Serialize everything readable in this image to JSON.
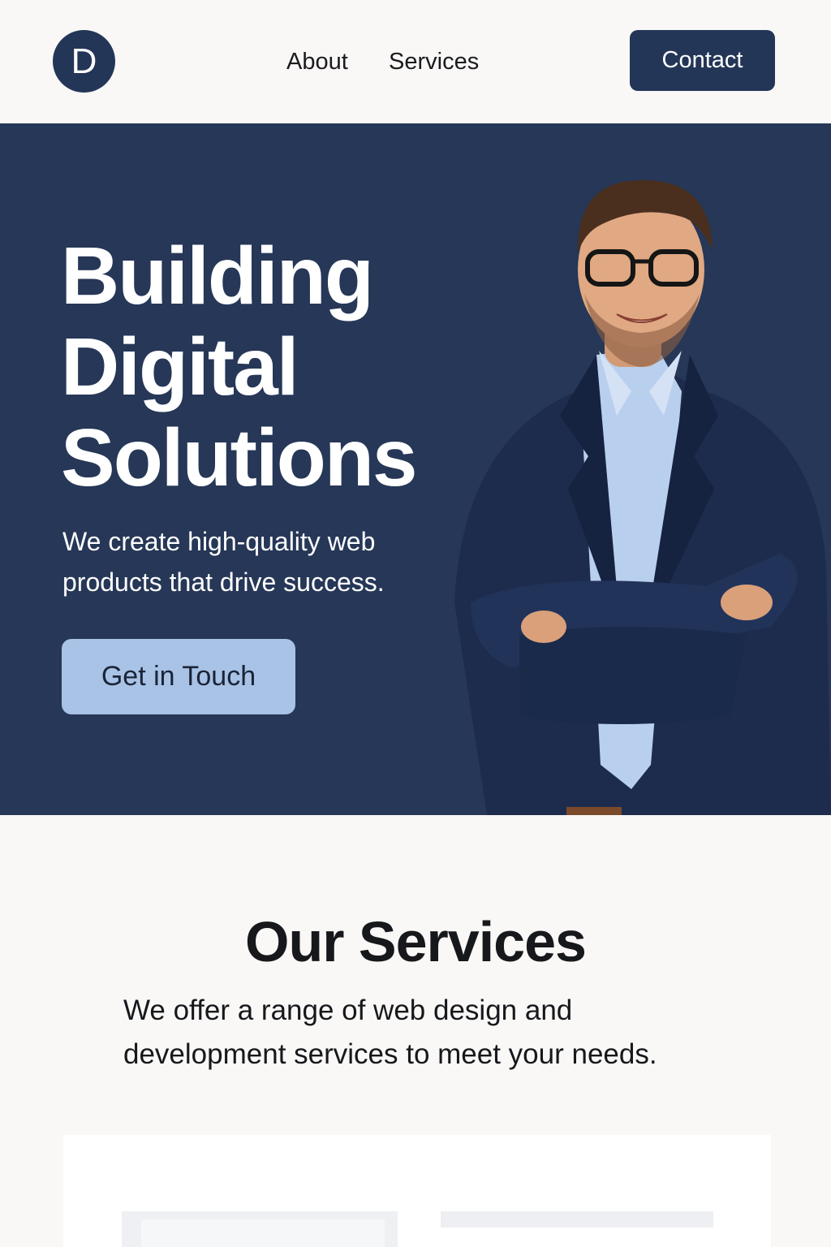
{
  "header": {
    "logo_letter": "D",
    "nav": [
      {
        "label": "About"
      },
      {
        "label": "Services"
      }
    ],
    "contact_label": "Contact"
  },
  "hero": {
    "title_lines": [
      "Building",
      "Digital",
      "Solutions"
    ],
    "subtitle": "We create high-quality web products that drive success.",
    "cta_label": "Get in Touch",
    "photo": "smiling man in navy suit with arms crossed"
  },
  "services": {
    "title": "Our Services",
    "description": "We offer a range of web design and development services to meet your needs."
  },
  "colors": {
    "brand_navy": "#233657",
    "hero_bg": "#263757",
    "cta_light_blue": "#a8c3e6",
    "page_bg": "#f9f8f6"
  }
}
